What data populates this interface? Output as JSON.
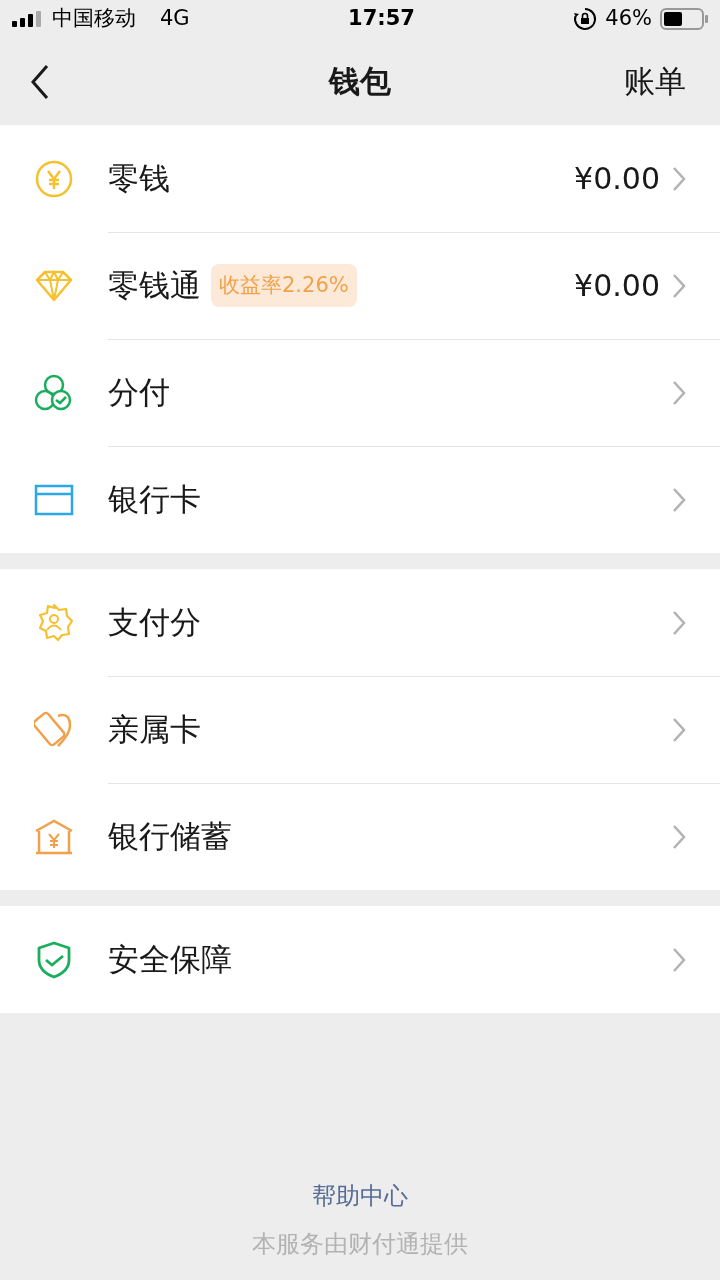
{
  "status_bar": {
    "carrier": "中国移动",
    "network": "4G",
    "time": "17:57",
    "battery": "46%"
  },
  "nav": {
    "title": "钱包",
    "action": "账单"
  },
  "groups": [
    {
      "items": [
        {
          "kind": "coin",
          "label": "零钱",
          "value": "¥0.00"
        },
        {
          "kind": "diamond",
          "label": "零钱通",
          "tag": "收益率2.26%",
          "value": "¥0.00"
        },
        {
          "kind": "circles",
          "label": "分付"
        },
        {
          "kind": "card",
          "label": "银行卡"
        }
      ]
    },
    {
      "items": [
        {
          "kind": "badge",
          "label": "支付分"
        },
        {
          "kind": "family",
          "label": "亲属卡"
        },
        {
          "kind": "bank",
          "label": "银行储蓄"
        }
      ]
    },
    {
      "items": [
        {
          "kind": "shield",
          "label": "安全保障"
        }
      ]
    }
  ],
  "footer": {
    "link": "帮助中心",
    "note": "本服务由财付通提供"
  }
}
